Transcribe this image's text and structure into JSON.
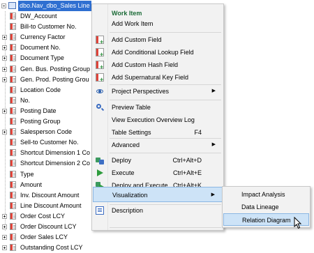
{
  "tree": {
    "root_label": "dbo.Nav_dbo_Sales Line",
    "fields": [
      {
        "label": "DW_Account",
        "expandable": false
      },
      {
        "label": "Bill-to Customer No.",
        "expandable": false
      },
      {
        "label": "Currency Factor",
        "expandable": true
      },
      {
        "label": "Document No.",
        "expandable": true
      },
      {
        "label": "Document Type",
        "expandable": true
      },
      {
        "label": "Gen. Bus. Posting Group",
        "expandable": true
      },
      {
        "label": "Gen. Prod. Posting Grou",
        "expandable": true
      },
      {
        "label": "Location Code",
        "expandable": false
      },
      {
        "label": "No.",
        "expandable": false
      },
      {
        "label": "Posting Date",
        "expandable": true
      },
      {
        "label": "Posting Group",
        "expandable": false
      },
      {
        "label": "Salesperson Code",
        "expandable": true
      },
      {
        "label": "Sell-to Customer No.",
        "expandable": false
      },
      {
        "label": "Shortcut Dimension 1 Co",
        "expandable": false
      },
      {
        "label": "Shortcut Dimension 2 Co",
        "expandable": false
      },
      {
        "label": "Type",
        "expandable": false
      },
      {
        "label": "Amount",
        "expandable": false
      },
      {
        "label": "Inv. Discount Amount",
        "expandable": false
      },
      {
        "label": "Line Discount Amount",
        "expandable": false
      },
      {
        "label": "Order Cost LCY",
        "expandable": true
      },
      {
        "label": "Order Discount LCY",
        "expandable": true
      },
      {
        "label": "Order Sales LCY",
        "expandable": true
      },
      {
        "label": "Outstanding Cost LCY",
        "expandable": true
      }
    ]
  },
  "menu": {
    "header": "Work Item",
    "add_work_item": "Add Work Item",
    "add_custom_field": "Add Custom Field",
    "add_conditional_lookup_field": "Add Conditional Lookup Field",
    "add_custom_hash_field": "Add Custom Hash Field",
    "add_supernatural_key_field": "Add Supernatural Key Field",
    "project_perspectives": "Project Perspectives",
    "preview_table": "Preview Table",
    "view_execution_overview_log": "View Execution Overview Log",
    "table_settings": "Table Settings",
    "table_settings_shortcut": "F4",
    "advanced": "Advanced",
    "deploy": "Deploy",
    "deploy_shortcut": "Ctrl+Alt+D",
    "execute": "Execute",
    "execute_shortcut": "Ctrl+Alt+E",
    "deploy_and_execute": "Deploy and Execute",
    "deploy_and_execute_shortcut": "Ctrl+Alt+K",
    "visualization": "Visualization",
    "description": "Description"
  },
  "submenu": {
    "impact_analysis": "Impact Analysis",
    "data_lineage": "Data Lineage",
    "relation_diagram": "Relation Diagram"
  }
}
